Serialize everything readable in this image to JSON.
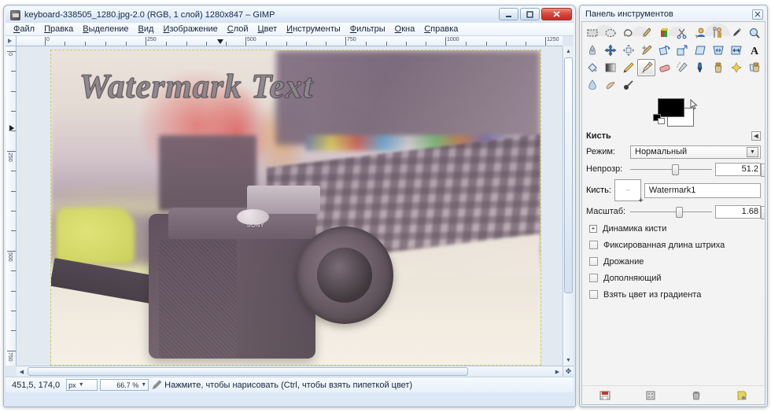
{
  "window": {
    "title": "keyboard-338505_1280.jpg-2.0 (RGB, 1 слой) 1280x847 – GIMP",
    "app_icon": "gimp-icon",
    "controls": {
      "minimize": "—",
      "maximize": "□",
      "close": "✕"
    }
  },
  "menu": {
    "items": [
      {
        "label": "Файл"
      },
      {
        "label": "Правка"
      },
      {
        "label": "Выделение"
      },
      {
        "label": "Вид"
      },
      {
        "label": "Изображение"
      },
      {
        "label": "Слой"
      },
      {
        "label": "Цвет"
      },
      {
        "label": "Инструменты"
      },
      {
        "label": "Фильтры"
      },
      {
        "label": "Окна"
      },
      {
        "label": "Справка"
      }
    ]
  },
  "rulers": {
    "unit": "px",
    "horizontal_labels": [
      "0",
      "250",
      "500",
      "750",
      "1000",
      "1250"
    ],
    "vertical_labels": [
      "0",
      "250",
      "500",
      "750"
    ]
  },
  "canvas": {
    "watermark_text": "Watermark Text",
    "image_name": "keyboard-338505_1280.jpg",
    "image_size": "1280x847",
    "color_mode": "RGB",
    "layer_count": "1 слой",
    "selection_style": "dashed-marching-ants"
  },
  "statusbar": {
    "pointer_position": "451,5, 174,0",
    "unit": "px",
    "zoom": "66.7 %",
    "message": "Нажмите, чтобы нарисовать (Ctrl, чтобы взять пипеткой цвет)",
    "tool_icon": "paintbrush-icon"
  },
  "toolbox": {
    "title": "Панель инструментов",
    "close_label": "✕",
    "tools": [
      {
        "name": "rect-select-icon"
      },
      {
        "name": "ellipse-select-icon"
      },
      {
        "name": "free-select-icon"
      },
      {
        "name": "fuzzy-select-icon"
      },
      {
        "name": "select-by-color-icon"
      },
      {
        "name": "scissors-select-icon"
      },
      {
        "name": "foreground-select-icon"
      },
      {
        "name": "paths-icon"
      },
      {
        "name": "color-picker-icon"
      },
      {
        "name": "zoom-icon"
      },
      {
        "name": "measure-icon"
      },
      {
        "name": "move-icon"
      },
      {
        "name": "alignment-icon"
      },
      {
        "name": "crop-icon"
      },
      {
        "name": "rotate-icon"
      },
      {
        "name": "scale-icon"
      },
      {
        "name": "shear-icon"
      },
      {
        "name": "perspective-icon"
      },
      {
        "name": "flip-icon"
      },
      {
        "name": "text-icon"
      },
      {
        "name": "bucket-fill-icon"
      },
      {
        "name": "gradient-icon"
      },
      {
        "name": "pencil-icon"
      },
      {
        "name": "paintbrush-icon"
      },
      {
        "name": "eraser-icon"
      },
      {
        "name": "airbrush-icon"
      },
      {
        "name": "ink-icon"
      },
      {
        "name": "clone-icon"
      },
      {
        "name": "heal-icon"
      },
      {
        "name": "perspective-clone-icon"
      },
      {
        "name": "blur-sharpen-icon"
      },
      {
        "name": "smudge-icon"
      },
      {
        "name": "dodge-burn-icon"
      }
    ],
    "selected_tool_index": 23,
    "colors": {
      "foreground": "#000000",
      "background": "#ffffff",
      "fg_label": "foreground-color-swatch",
      "bg_label": "background-color-swatch"
    }
  },
  "tool_options": {
    "heading": "Кисть",
    "collapse_label": "◀",
    "mode": {
      "label": "Режим:",
      "value": "Нормальный"
    },
    "opacity": {
      "label": "Непрозр:",
      "value": "51.2",
      "percent": 51.2
    },
    "brush": {
      "label": "Кисть:",
      "value": "Watermark1",
      "preview_mark": "~"
    },
    "scale": {
      "label": "Масштаб:",
      "value": "1.68",
      "percent": 56
    },
    "checkboxes": [
      {
        "label": "Динамика кисти",
        "type": "expander",
        "checked": false
      },
      {
        "label": "Фиксированная длина штриха",
        "type": "checkbox",
        "checked": false
      },
      {
        "label": "Дрожание",
        "type": "checkbox",
        "checked": false
      },
      {
        "label": "Дополняющий",
        "type": "checkbox",
        "checked": false
      },
      {
        "label": "Взять цвет из градиента",
        "type": "checkbox",
        "checked": false
      }
    ],
    "footer_buttons": [
      {
        "name": "save-tool-options-icon"
      },
      {
        "name": "restore-tool-options-icon"
      },
      {
        "name": "delete-tool-options-icon"
      },
      {
        "name": "reset-tool-options-icon"
      }
    ]
  },
  "colors": {
    "accent": "#3a6ea5",
    "close_red": "#c22c22",
    "selection_yellow": "#c9c96a",
    "panel_bg": "#f3f3f3"
  }
}
